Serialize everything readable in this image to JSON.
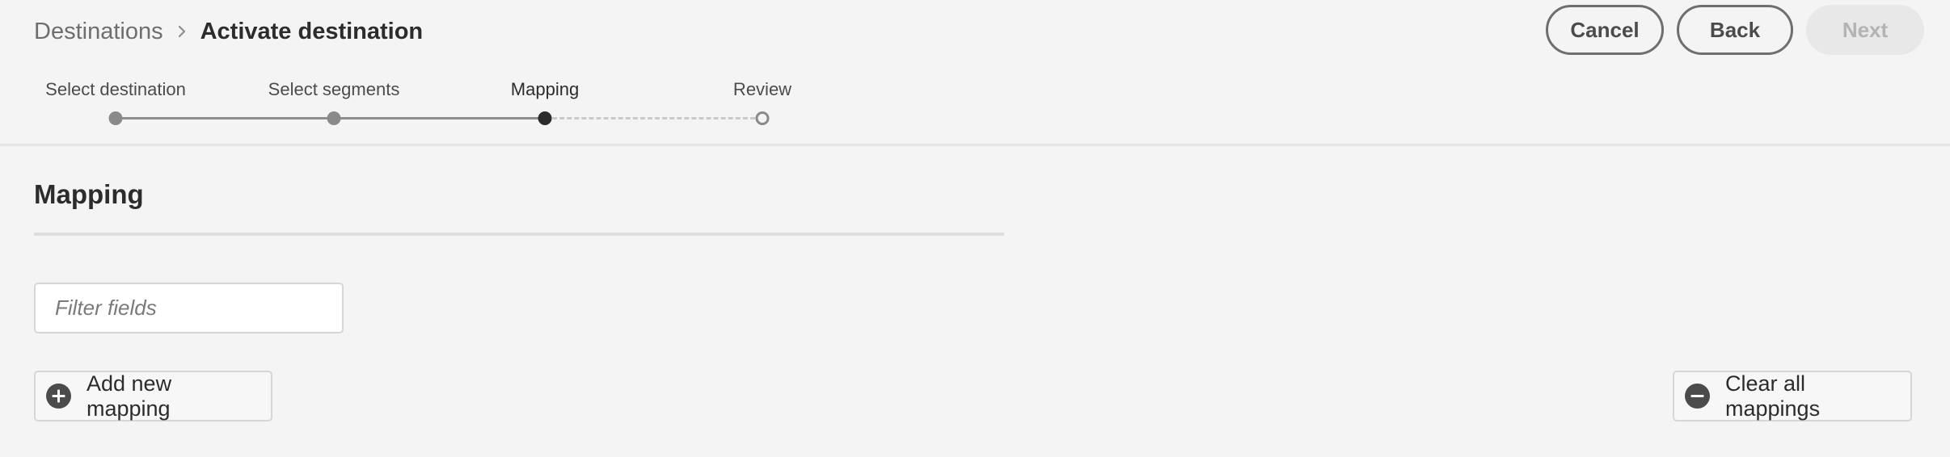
{
  "breadcrumb": {
    "parent": "Destinations",
    "current": "Activate destination"
  },
  "header_actions": {
    "cancel_label": "Cancel",
    "back_label": "Back",
    "next_label": "Next",
    "next_enabled": false
  },
  "stepper": {
    "steps": [
      {
        "label": "Select destination",
        "state": "done"
      },
      {
        "label": "Select segments",
        "state": "done"
      },
      {
        "label": "Mapping",
        "state": "current"
      },
      {
        "label": "Review",
        "state": "future"
      }
    ]
  },
  "mapping": {
    "title": "Mapping",
    "filter_placeholder": "Filter fields",
    "add_label": "Add new mapping",
    "clear_label": "Clear all mappings"
  },
  "icons": {
    "breadcrumb_separator": "chevron-right-icon",
    "add": "add-circle-icon",
    "clear": "remove-circle-icon"
  },
  "colors": {
    "background": "#f4f4f4",
    "text_primary": "#2c2c2c",
    "text_secondary": "#6e6e6e",
    "step_done": "#8a8a8a",
    "step_current": "#2c2c2c",
    "disabled_button_bg": "#e8e8e8",
    "disabled_button_text": "#b3b3b3"
  }
}
